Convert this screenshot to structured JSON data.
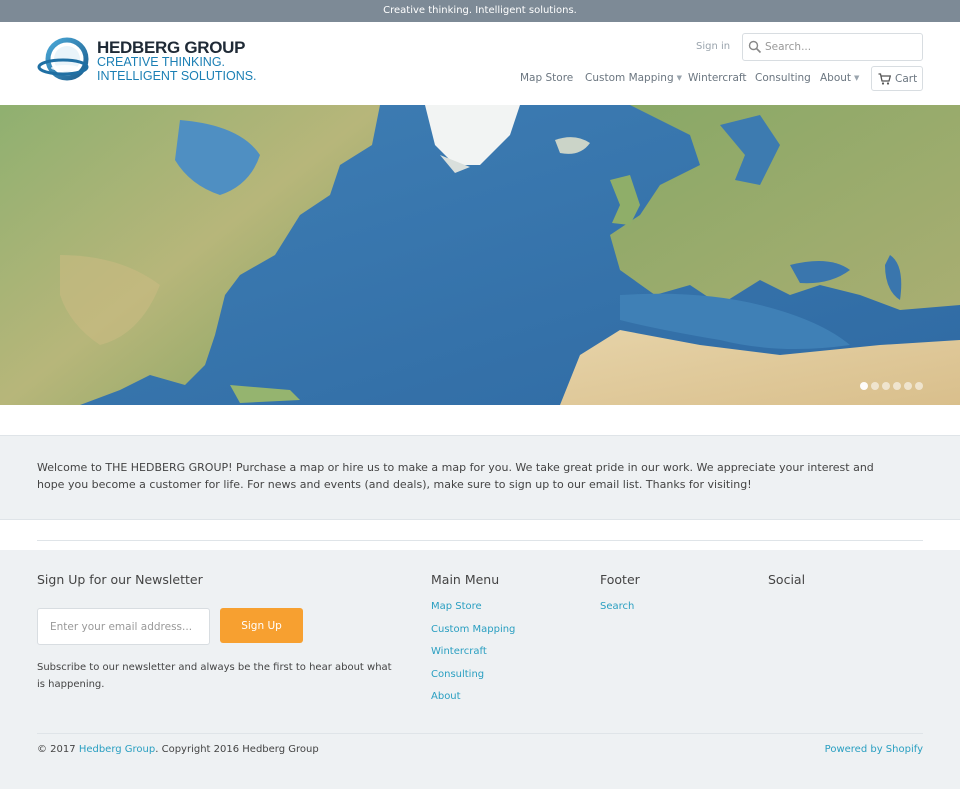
{
  "announcement": "Creative thinking. Intelligent solutions.",
  "logo": {
    "name": "HEDBERG GROUP",
    "tagline_line1": "CREATIVE THINKING.",
    "tagline_line2": "INTELLIGENT SOLUTIONS."
  },
  "header": {
    "sign_in": "Sign in",
    "search_placeholder": "Search...",
    "cart_label": "Cart"
  },
  "nav": {
    "items": [
      {
        "label": "Map Store",
        "has_dropdown": false
      },
      {
        "label": "Custom Mapping",
        "has_dropdown": true
      },
      {
        "label": "Wintercraft",
        "has_dropdown": false
      },
      {
        "label": "Consulting",
        "has_dropdown": false
      },
      {
        "label": "About",
        "has_dropdown": true
      }
    ],
    "caret": "▼"
  },
  "welcome": {
    "text": "Welcome to THE HEDBERG GROUP!  Purchase a map or hire us to make a map for you.  We take great pride in our work.  We appreciate your interest and hope you become a customer for life.  For news and events (and deals), make sure to sign up to our email list.  Thanks for visiting!"
  },
  "footer": {
    "newsletter": {
      "title": "Sign Up for our Newsletter",
      "email_placeholder": "Enter your email address...",
      "button_label": "Sign Up",
      "subtext": "Subscribe to our newsletter and always be the first to hear about what is happening."
    },
    "main_menu": {
      "title": "Main Menu",
      "links": [
        "Map Store",
        "Custom Mapping",
        "Wintercraft",
        "Consulting",
        "About"
      ]
    },
    "footer_menu": {
      "title": "Footer",
      "links": [
        "Search"
      ]
    },
    "social": {
      "title": "Social"
    },
    "copyright_prefix": "© 2017 ",
    "copyright_link": "Hedberg Group",
    "copyright_suffix": ". Copyright 2016 Hedberg Group",
    "powered_by": "Powered by Shopify"
  },
  "colors": {
    "topbar": "#7d8a96",
    "accent_link": "#2a9fc1",
    "button_orange": "#f7a030",
    "logo_blue": "#1b7fb4"
  },
  "icons": {
    "search": "search-icon",
    "cart": "cart-icon"
  }
}
